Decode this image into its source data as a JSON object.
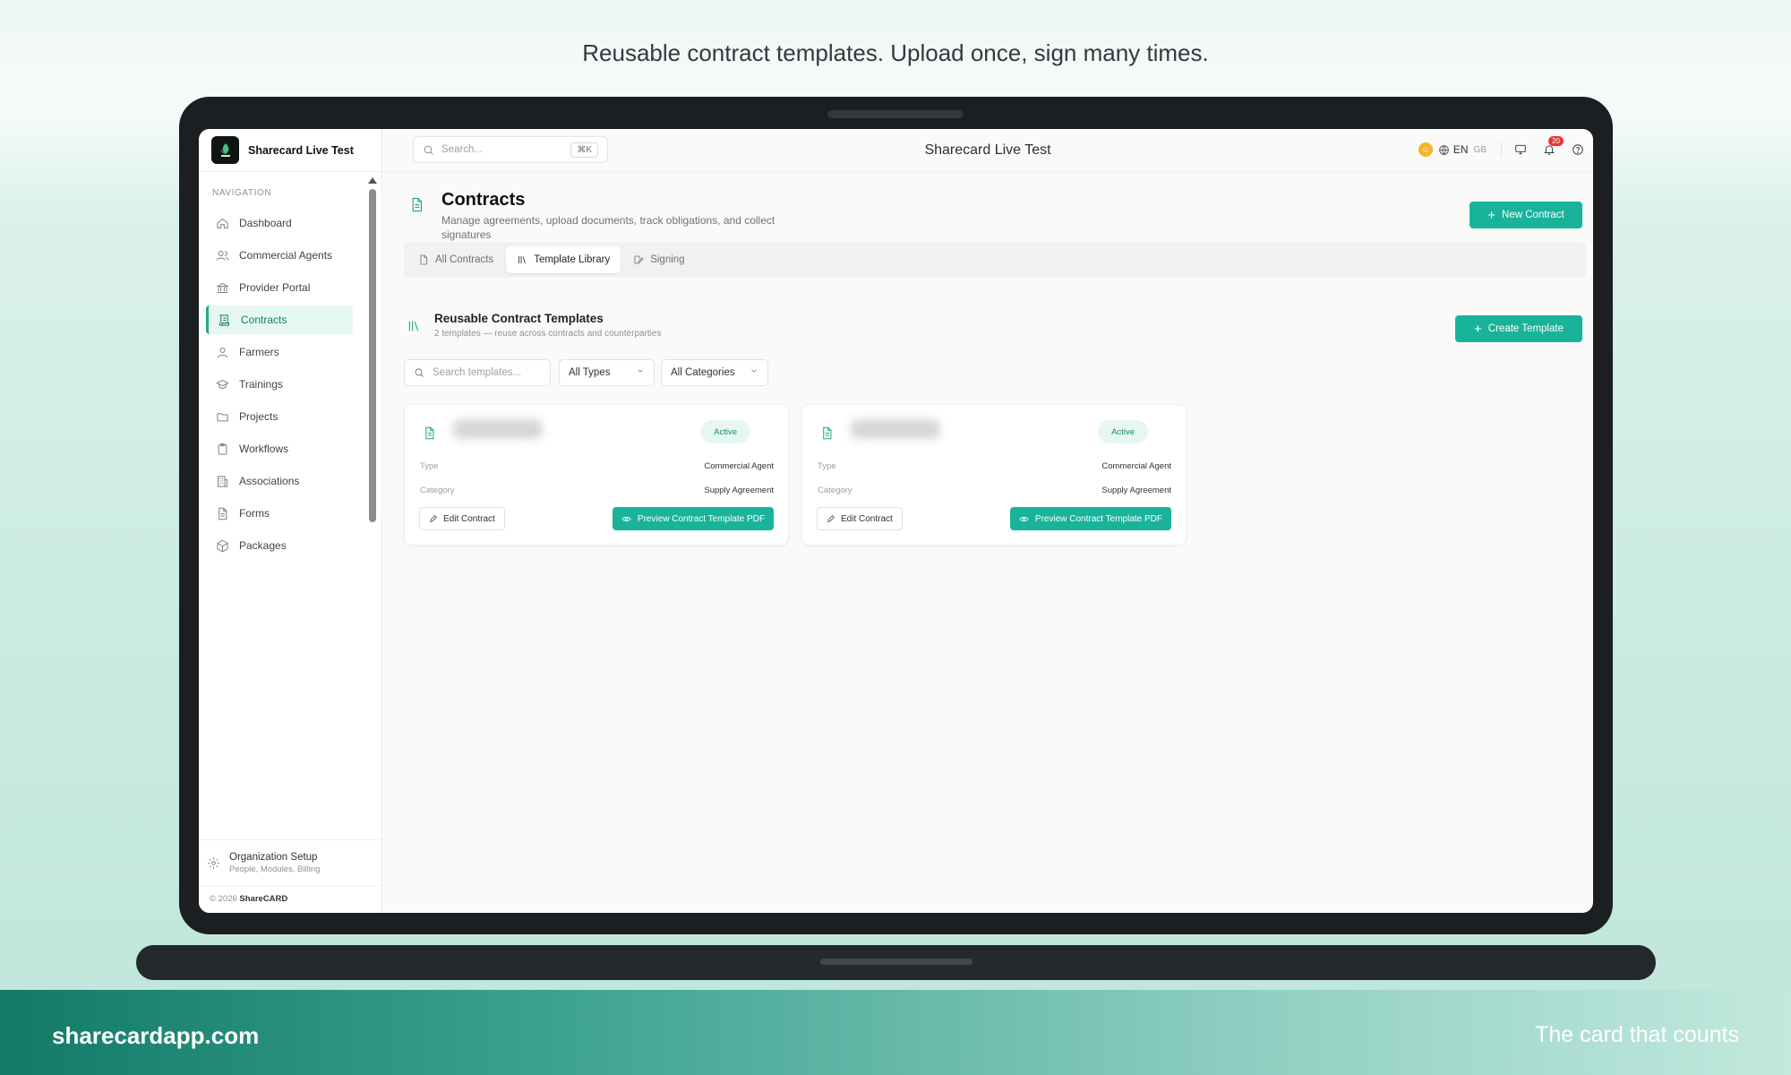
{
  "marketing": {
    "tagline": "Reusable contract templates. Upload once, sign many times.",
    "footer_left": "sharecardapp.com",
    "footer_right": "The card that counts"
  },
  "sidebar": {
    "brand": "Sharecard Live Test",
    "section_label": "NAVIGATION",
    "items": [
      {
        "label": "Dashboard",
        "icon": "home-icon"
      },
      {
        "label": "Commercial Agents",
        "icon": "users-icon"
      },
      {
        "label": "Provider Portal",
        "icon": "landmark-icon"
      },
      {
        "label": "Contracts",
        "icon": "scroll-icon",
        "active": true
      },
      {
        "label": "Farmers",
        "icon": "user-icon"
      },
      {
        "label": "Trainings",
        "icon": "graduation-cap-icon"
      },
      {
        "label": "Projects",
        "icon": "folder-icon"
      },
      {
        "label": "Workflows",
        "icon": "clipboard-icon"
      },
      {
        "label": "Associations",
        "icon": "building-icon"
      },
      {
        "label": "Forms",
        "icon": "file-text-icon"
      },
      {
        "label": "Packages",
        "icon": "package-icon"
      }
    ],
    "org_setup": {
      "title": "Organization Setup",
      "subtitle": "People, Modules, Billing"
    },
    "copyright_prefix": "© 2026",
    "copyright_brand": "ShareCARD"
  },
  "topbar": {
    "search_placeholder": "Search...",
    "shortcut": "⌘K",
    "title": "Sharecard Live Test",
    "language": "EN",
    "region": "GB",
    "notification_count": "20"
  },
  "page": {
    "title": "Contracts",
    "subtitle": "Manage agreements, upload documents, track obligations, and collect signatures",
    "new_button": "New Contract",
    "tabs": [
      {
        "label": "All Contracts",
        "active": false
      },
      {
        "label": "Template Library",
        "active": true
      },
      {
        "label": "Signing",
        "active": false
      }
    ]
  },
  "templates": {
    "title": "Reusable Contract Templates",
    "subtitle": "2 templates — reuse across contracts and counterparties",
    "create_button": "Create Template",
    "search_placeholder": "Search templates...",
    "type_filter": "All Types",
    "category_filter": "All Categories",
    "type_label": "Type",
    "category_label": "Category",
    "edit_label": "Edit Contract",
    "preview_label": "Preview Contract Template PDF",
    "cards": [
      {
        "status": "Active",
        "type": "Commercial Agent",
        "category": "Supply Agreement"
      },
      {
        "status": "Active",
        "type": "Commercial Agent",
        "category": "Supply Agreement"
      }
    ]
  },
  "colors": {
    "accent": "#19b39a",
    "active_nav_bg": "#e7f7f1",
    "status_bg": "#e6f7f0",
    "badge": "#e53935"
  }
}
